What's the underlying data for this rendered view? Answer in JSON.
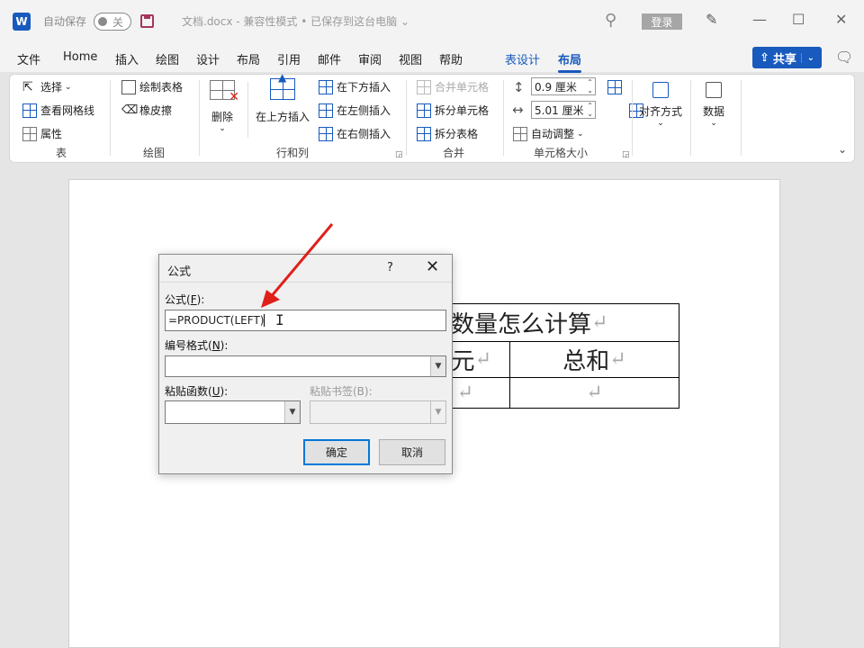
{
  "titlebar": {
    "logo": "W",
    "autosave_label": "自动保存",
    "autosave_state": "关",
    "doc_title": "文档.docx  -  兼容性模式 • 已保存到这台电脑 ⌄",
    "login": "登录"
  },
  "tabs": [
    "文件",
    "Home",
    "插入",
    "绘图",
    "设计",
    "布局",
    "引用",
    "邮件",
    "审阅",
    "视图",
    "帮助"
  ],
  "context_tabs": {
    "table_design": "表设计",
    "layout": "布局"
  },
  "share_label": "共享",
  "ribbon": {
    "table": {
      "select": "选择",
      "gridlines": "查看网格线",
      "properties": "属性",
      "label": "表"
    },
    "draw": {
      "draw_table": "绘制表格",
      "eraser": "橡皮擦",
      "label": "绘图"
    },
    "rows_cols": {
      "delete": "删除",
      "insert_above": "在上方插入",
      "insert_below": "在下方插入",
      "insert_left": "在左侧插入",
      "insert_right": "在右侧插入",
      "label": "行和列"
    },
    "merge": {
      "merge_cells": "合并单元格",
      "split_cells": "拆分单元格",
      "split_table": "拆分表格",
      "label": "合并"
    },
    "cell_size": {
      "height": "0.9 厘米",
      "width": "5.01 厘米",
      "autofit": "自动调整",
      "label": "单元格大小"
    },
    "alignment": "对齐方式",
    "data": "数据"
  },
  "table": {
    "header": "数量怎么计算",
    "row2_col1": "元",
    "row2_col2": "总和",
    "return_mark": "↵"
  },
  "dialog": {
    "title": "公式",
    "help": "?",
    "formula_label_prefix": "公式(",
    "formula_label_key": "F",
    "formula_label_suffix": "):",
    "formula_value": "=PRODUCT(LEFT)",
    "number_format_label_prefix": "编号格式(",
    "number_format_label_key": "N",
    "number_format_label_suffix": "):",
    "paste_function_label_prefix": "粘贴函数(",
    "paste_function_label_key": "U",
    "paste_function_label_suffix": "):",
    "paste_bookmark_label": "粘贴书签(B):",
    "ok": "确定",
    "cancel": "取消"
  },
  "colors": {
    "accent": "#185abd",
    "annotation_arrow": "#e0201b"
  }
}
